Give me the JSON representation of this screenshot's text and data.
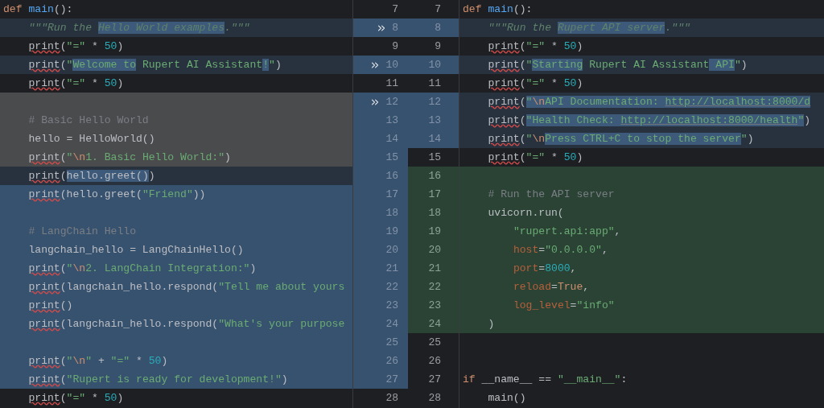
{
  "rows": [
    {
      "left": {
        "num": "7",
        "kind": "unchanged",
        "apply": false,
        "tokens": [
          {
            "text": "def ",
            "kind": "keyword",
            "highlighted": false
          },
          {
            "text": "main",
            "kind": "function",
            "highlighted": false
          },
          {
            "text": "():",
            "kind": "plain",
            "highlighted": false
          }
        ]
      },
      "right": {
        "num": "7",
        "kind": "unchanged",
        "tokens": [
          {
            "text": "def ",
            "kind": "keyword",
            "highlighted": false
          },
          {
            "text": "main",
            "kind": "function",
            "highlighted": false
          },
          {
            "text": "():",
            "kind": "plain",
            "highlighted": false
          }
        ]
      }
    },
    {
      "left": {
        "num": "8",
        "kind": "modified",
        "apply": true,
        "tokens": [
          {
            "text": "    \"\"\"Run the ",
            "kind": "docstring",
            "highlighted": false
          },
          {
            "text": "Hello World examples",
            "kind": "docstring",
            "highlighted": true
          },
          {
            "text": ".\"\"\"",
            "kind": "docstring",
            "highlighted": false
          }
        ]
      },
      "right": {
        "num": "8",
        "kind": "modified",
        "tokens": [
          {
            "text": "    \"\"\"Run the ",
            "kind": "docstring",
            "highlighted": false
          },
          {
            "text": "Rupert API server",
            "kind": "docstring",
            "highlighted": true
          },
          {
            "text": ".\"\"\"",
            "kind": "docstring",
            "highlighted": false
          }
        ]
      }
    },
    {
      "left": {
        "num": "9",
        "kind": "unchanged",
        "apply": false,
        "tokens": [
          {
            "text": "    print",
            "kind": "warning",
            "highlighted": false
          },
          {
            "text": "(",
            "kind": "plain",
            "highlighted": false
          },
          {
            "text": "\"=\"",
            "kind": "string",
            "highlighted": false
          },
          {
            "text": " * ",
            "kind": "plain",
            "highlighted": false
          },
          {
            "text": "50",
            "kind": "number",
            "highlighted": false
          },
          {
            "text": ")",
            "kind": "plain",
            "highlighted": false
          }
        ]
      },
      "right": {
        "num": "9",
        "kind": "unchanged",
        "tokens": [
          {
            "text": "    print",
            "kind": "warning",
            "highlighted": false
          },
          {
            "text": "(",
            "kind": "plain",
            "highlighted": false
          },
          {
            "text": "\"=\"",
            "kind": "string",
            "highlighted": false
          },
          {
            "text": " * ",
            "kind": "plain",
            "highlighted": false
          },
          {
            "text": "50",
            "kind": "number",
            "highlighted": false
          },
          {
            "text": ")",
            "kind": "plain",
            "highlighted": false
          }
        ]
      }
    },
    {
      "left": {
        "num": "10",
        "kind": "modified",
        "apply": true,
        "tokens": [
          {
            "text": "    print",
            "kind": "warning",
            "highlighted": false
          },
          {
            "text": "(",
            "kind": "plain",
            "highlighted": false
          },
          {
            "text": "\"",
            "kind": "string",
            "highlighted": false
          },
          {
            "text": "Welcome to",
            "kind": "string",
            "highlighted": true
          },
          {
            "text": " Rupert AI Assistant",
            "kind": "string",
            "highlighted": false
          },
          {
            "text": "!",
            "kind": "string",
            "highlighted": true
          },
          {
            "text": "\"",
            "kind": "string",
            "highlighted": false
          },
          {
            "text": ")",
            "kind": "plain",
            "highlighted": false
          }
        ]
      },
      "right": {
        "num": "10",
        "kind": "modified",
        "tokens": [
          {
            "text": "    print",
            "kind": "warning",
            "highlighted": false
          },
          {
            "text": "(",
            "kind": "plain",
            "highlighted": false
          },
          {
            "text": "\"",
            "kind": "string",
            "highlighted": false
          },
          {
            "text": "Starting",
            "kind": "string",
            "highlighted": true
          },
          {
            "text": " Rupert AI Assistant",
            "kind": "string",
            "highlighted": false
          },
          {
            "text": " API",
            "kind": "string",
            "highlighted": true
          },
          {
            "text": "\"",
            "kind": "string",
            "highlighted": false
          },
          {
            "text": ")",
            "kind": "plain",
            "highlighted": false
          }
        ]
      }
    },
    {
      "left": {
        "num": "11",
        "kind": "unchanged",
        "apply": false,
        "tokens": [
          {
            "text": "    print",
            "kind": "warning",
            "highlighted": false
          },
          {
            "text": "(",
            "kind": "plain",
            "highlighted": false
          },
          {
            "text": "\"=\"",
            "kind": "string",
            "highlighted": false
          },
          {
            "text": " * ",
            "kind": "plain",
            "highlighted": false
          },
          {
            "text": "50",
            "kind": "number",
            "highlighted": false
          },
          {
            "text": ")",
            "kind": "plain",
            "highlighted": false
          }
        ]
      },
      "right": {
        "num": "11",
        "kind": "unchanged",
        "tokens": [
          {
            "text": "    print",
            "kind": "warning",
            "highlighted": false
          },
          {
            "text": "(",
            "kind": "plain",
            "highlighted": false
          },
          {
            "text": "\"=\"",
            "kind": "string",
            "highlighted": false
          },
          {
            "text": " * ",
            "kind": "plain",
            "highlighted": false
          },
          {
            "text": "50",
            "kind": "number",
            "highlighted": false
          },
          {
            "text": ")",
            "kind": "plain",
            "highlighted": false
          }
        ]
      }
    },
    {
      "left": {
        "num": "12",
        "kind": "ignored",
        "apply": true
      },
      "right": {
        "num": "12",
        "kind": "modified",
        "tokens": [
          {
            "text": "    print",
            "kind": "warning",
            "highlighted": false
          },
          {
            "text": "(",
            "kind": "plain",
            "highlighted": false
          },
          {
            "text": "\"",
            "kind": "string",
            "highlighted": true
          },
          {
            "text": "\\n",
            "kind": "escape",
            "highlighted": true
          },
          {
            "text": "API Documentation: ",
            "kind": "string",
            "highlighted": true
          },
          {
            "text": "http://localhost:8000/d",
            "kind": "link",
            "highlighted": true
          }
        ]
      }
    },
    {
      "left": {
        "num": "13",
        "kind": "ignored",
        "apply": false,
        "tokens": [
          {
            "text": "    # Basic Hello World",
            "kind": "comment",
            "highlighted": false
          }
        ]
      },
      "right": {
        "num": "13",
        "kind": "modified",
        "tokens": [
          {
            "text": "    print",
            "kind": "warning",
            "highlighted": false
          },
          {
            "text": "(",
            "kind": "plain",
            "highlighted": false
          },
          {
            "text": "\"Health Check: ",
            "kind": "string",
            "highlighted": true
          },
          {
            "text": "http://localhost:8000/health",
            "kind": "link",
            "highlighted": true
          },
          {
            "text": "\"",
            "kind": "string",
            "highlighted": true
          },
          {
            "text": ")",
            "kind": "plain",
            "highlighted": false
          }
        ]
      }
    },
    {
      "left": {
        "num": "14",
        "kind": "ignored",
        "apply": false,
        "tokens": [
          {
            "text": "    hello = HelloWorld()",
            "kind": "plain",
            "highlighted": false
          }
        ]
      },
      "right": {
        "num": "14",
        "kind": "modified",
        "tokens": [
          {
            "text": "    print",
            "kind": "warning",
            "highlighted": false
          },
          {
            "text": "(",
            "kind": "plain",
            "highlighted": false
          },
          {
            "text": "\"",
            "kind": "string",
            "highlighted": false
          },
          {
            "text": "\\n",
            "kind": "escape",
            "highlighted": false
          },
          {
            "text": "Press CTRL+C to stop the server",
            "kind": "string",
            "highlighted": true
          },
          {
            "text": "\"",
            "kind": "string",
            "highlighted": false
          },
          {
            "text": ")",
            "kind": "plain",
            "highlighted": false
          }
        ]
      }
    },
    {
      "left": {
        "num": "15",
        "kind": "ignored",
        "apply": false,
        "tokens": [
          {
            "text": "    print",
            "kind": "warning",
            "highlighted": false
          },
          {
            "text": "(",
            "kind": "plain",
            "highlighted": false
          },
          {
            "text": "\"",
            "kind": "string",
            "highlighted": false
          },
          {
            "text": "\\n",
            "kind": "escape",
            "highlighted": false
          },
          {
            "text": "1. Basic Hello World:\"",
            "kind": "string",
            "highlighted": false
          },
          {
            "text": ")",
            "kind": "plain",
            "highlighted": false
          }
        ]
      },
      "right": {
        "num": "15",
        "kind": "unchanged",
        "tokens": [
          {
            "text": "    print",
            "kind": "warning",
            "highlighted": false
          },
          {
            "text": "(",
            "kind": "plain",
            "highlighted": false
          },
          {
            "text": "\"=\"",
            "kind": "string",
            "highlighted": false
          },
          {
            "text": " * ",
            "kind": "plain",
            "highlighted": false
          },
          {
            "text": "50",
            "kind": "number",
            "highlighted": false
          },
          {
            "text": ")",
            "kind": "plain",
            "highlighted": false
          }
        ]
      }
    },
    {
      "left": {
        "num": "16",
        "kind": "modified",
        "apply": false,
        "tokens": [
          {
            "text": "    print",
            "kind": "warning",
            "highlighted": false
          },
          {
            "text": "(",
            "kind": "plain",
            "highlighted": false
          },
          {
            "text": "hello.greet()",
            "kind": "plain",
            "highlighted": true
          },
          {
            "text": ")",
            "kind": "plain",
            "highlighted": false
          }
        ]
      },
      "right": {
        "num": "16",
        "kind": "added"
      }
    },
    {
      "left": {
        "num": "17",
        "kind": "changed",
        "apply": false,
        "tokens": [
          {
            "text": "    print",
            "kind": "warning",
            "highlighted": false
          },
          {
            "text": "(hello.greet(",
            "kind": "plain",
            "highlighted": false
          },
          {
            "text": "\"Friend\"",
            "kind": "string",
            "highlighted": false
          },
          {
            "text": "))",
            "kind": "plain",
            "highlighted": false
          }
        ]
      },
      "right": {
        "num": "17",
        "kind": "added",
        "tokens": [
          {
            "text": "    # Run the API server",
            "kind": "comment",
            "highlighted": false
          }
        ]
      }
    },
    {
      "left": {
        "num": "18",
        "kind": "changed",
        "apply": false
      },
      "right": {
        "num": "18",
        "kind": "added",
        "tokens": [
          {
            "text": "    uvicorn.run(",
            "kind": "plain",
            "highlighted": false
          }
        ]
      }
    },
    {
      "left": {
        "num": "19",
        "kind": "changed",
        "apply": false,
        "tokens": [
          {
            "text": "    # LangChain Hello",
            "kind": "comment",
            "highlighted": false
          }
        ]
      },
      "right": {
        "num": "19",
        "kind": "added",
        "tokens": [
          {
            "text": "        \"rupert.api:app\"",
            "kind": "string",
            "highlighted": false
          },
          {
            "text": ",",
            "kind": "plain",
            "highlighted": false
          }
        ]
      }
    },
    {
      "left": {
        "num": "20",
        "kind": "changed",
        "apply": false,
        "tokens": [
          {
            "text": "    langchain_hello = LangChainHello()",
            "kind": "plain",
            "highlighted": false
          }
        ]
      },
      "right": {
        "num": "20",
        "kind": "added",
        "tokens": [
          {
            "text": "        host",
            "kind": "parameter",
            "highlighted": false
          },
          {
            "text": "=",
            "kind": "plain",
            "highlighted": false
          },
          {
            "text": "\"0.0.0.0\"",
            "kind": "string",
            "highlighted": false
          },
          {
            "text": ",",
            "kind": "plain",
            "highlighted": false
          }
        ]
      }
    },
    {
      "left": {
        "num": "21",
        "kind": "changed",
        "apply": false,
        "tokens": [
          {
            "text": "    print",
            "kind": "warning",
            "highlighted": false
          },
          {
            "text": "(",
            "kind": "plain",
            "highlighted": false
          },
          {
            "text": "\"",
            "kind": "string",
            "highlighted": false
          },
          {
            "text": "\\n",
            "kind": "escape",
            "highlighted": false
          },
          {
            "text": "2. LangChain Integration:\"",
            "kind": "string",
            "highlighted": false
          },
          {
            "text": ")",
            "kind": "plain",
            "highlighted": false
          }
        ]
      },
      "right": {
        "num": "21",
        "kind": "added",
        "tokens": [
          {
            "text": "        port",
            "kind": "parameter",
            "highlighted": false
          },
          {
            "text": "=",
            "kind": "plain",
            "highlighted": false
          },
          {
            "text": "8000",
            "kind": "number",
            "highlighted": false
          },
          {
            "text": ",",
            "kind": "plain",
            "highlighted": false
          }
        ]
      }
    },
    {
      "left": {
        "num": "22",
        "kind": "changed",
        "apply": false,
        "tokens": [
          {
            "text": "    print",
            "kind": "warning",
            "highlighted": false
          },
          {
            "text": "(langchain_hello.respond(",
            "kind": "plain",
            "highlighted": false
          },
          {
            "text": "\"Tell me about yours",
            "kind": "string",
            "highlighted": false
          }
        ]
      },
      "right": {
        "num": "22",
        "kind": "added",
        "tokens": [
          {
            "text": "        reload",
            "kind": "parameter",
            "highlighted": false
          },
          {
            "text": "=",
            "kind": "plain",
            "highlighted": false
          },
          {
            "text": "True",
            "kind": "keyword",
            "highlighted": false
          },
          {
            "text": ",",
            "kind": "plain",
            "highlighted": false
          }
        ]
      }
    },
    {
      "left": {
        "num": "23",
        "kind": "changed",
        "apply": false,
        "tokens": [
          {
            "text": "    print",
            "kind": "warning",
            "highlighted": false
          },
          {
            "text": "()",
            "kind": "plain",
            "highlighted": false
          }
        ]
      },
      "right": {
        "num": "23",
        "kind": "added",
        "tokens": [
          {
            "text": "        log_level",
            "kind": "parameter",
            "highlighted": false
          },
          {
            "text": "=",
            "kind": "plain",
            "highlighted": false
          },
          {
            "text": "\"info\"",
            "kind": "string",
            "highlighted": false
          }
        ]
      }
    },
    {
      "left": {
        "num": "24",
        "kind": "changed",
        "apply": false,
        "tokens": [
          {
            "text": "    print",
            "kind": "warning",
            "highlighted": false
          },
          {
            "text": "(langchain_hello.respond(",
            "kind": "plain",
            "highlighted": false
          },
          {
            "text": "\"What's your purpose",
            "kind": "string",
            "highlighted": false
          }
        ]
      },
      "right": {
        "num": "24",
        "kind": "added",
        "tokens": [
          {
            "text": "    )",
            "kind": "plain",
            "highlighted": false
          }
        ]
      }
    },
    {
      "left": {
        "num": "25",
        "kind": "changed",
        "apply": false
      },
      "right": {
        "num": "25",
        "kind": "unchanged"
      }
    },
    {
      "left": {
        "num": "26",
        "kind": "changed",
        "apply": false,
        "tokens": [
          {
            "text": "    print",
            "kind": "warning",
            "highlighted": false
          },
          {
            "text": "(",
            "kind": "plain",
            "highlighted": false
          },
          {
            "text": "\"",
            "kind": "string",
            "highlighted": false
          },
          {
            "text": "\\n",
            "kind": "escape",
            "highlighted": false
          },
          {
            "text": "\"",
            "kind": "string",
            "highlighted": false
          },
          {
            "text": " + ",
            "kind": "plain",
            "highlighted": false
          },
          {
            "text": "\"=\"",
            "kind": "string",
            "highlighted": false
          },
          {
            "text": " * ",
            "kind": "plain",
            "highlighted": false
          },
          {
            "text": "50",
            "kind": "number",
            "highlighted": false
          },
          {
            "text": ")",
            "kind": "plain",
            "highlighted": false
          }
        ]
      },
      "right": {
        "num": "26",
        "kind": "unchanged"
      }
    },
    {
      "left": {
        "num": "27",
        "kind": "changed",
        "apply": false,
        "tokens": [
          {
            "text": "    print",
            "kind": "warning",
            "highlighted": false
          },
          {
            "text": "(",
            "kind": "plain",
            "highlighted": false
          },
          {
            "text": "\"Rupert is ready for development!\"",
            "kind": "string",
            "highlighted": false
          },
          {
            "text": ")",
            "kind": "plain",
            "highlighted": false
          }
        ]
      },
      "right": {
        "num": "27",
        "kind": "unchanged",
        "tokens": [
          {
            "text": "if",
            "kind": "keyword",
            "highlighted": false
          },
          {
            "text": " __name__ == ",
            "kind": "plain",
            "highlighted": false
          },
          {
            "text": "\"__main__\"",
            "kind": "string",
            "highlighted": false
          },
          {
            "text": ":",
            "kind": "plain",
            "highlighted": false
          }
        ]
      }
    },
    {
      "left": {
        "num": "28",
        "kind": "unchanged",
        "apply": false,
        "tokens": [
          {
            "text": "    print",
            "kind": "warning",
            "highlighted": false
          },
          {
            "text": "(",
            "kind": "plain",
            "highlighted": false
          },
          {
            "text": "\"=\"",
            "kind": "string",
            "highlighted": false
          },
          {
            "text": " * ",
            "kind": "plain",
            "highlighted": false
          },
          {
            "text": "50",
            "kind": "number",
            "highlighted": false
          },
          {
            "text": ")",
            "kind": "plain",
            "highlighted": false
          }
        ]
      },
      "right": {
        "num": "28",
        "kind": "unchanged",
        "tokens": [
          {
            "text": "    main()",
            "kind": "plain",
            "highlighted": false
          }
        ]
      }
    }
  ]
}
